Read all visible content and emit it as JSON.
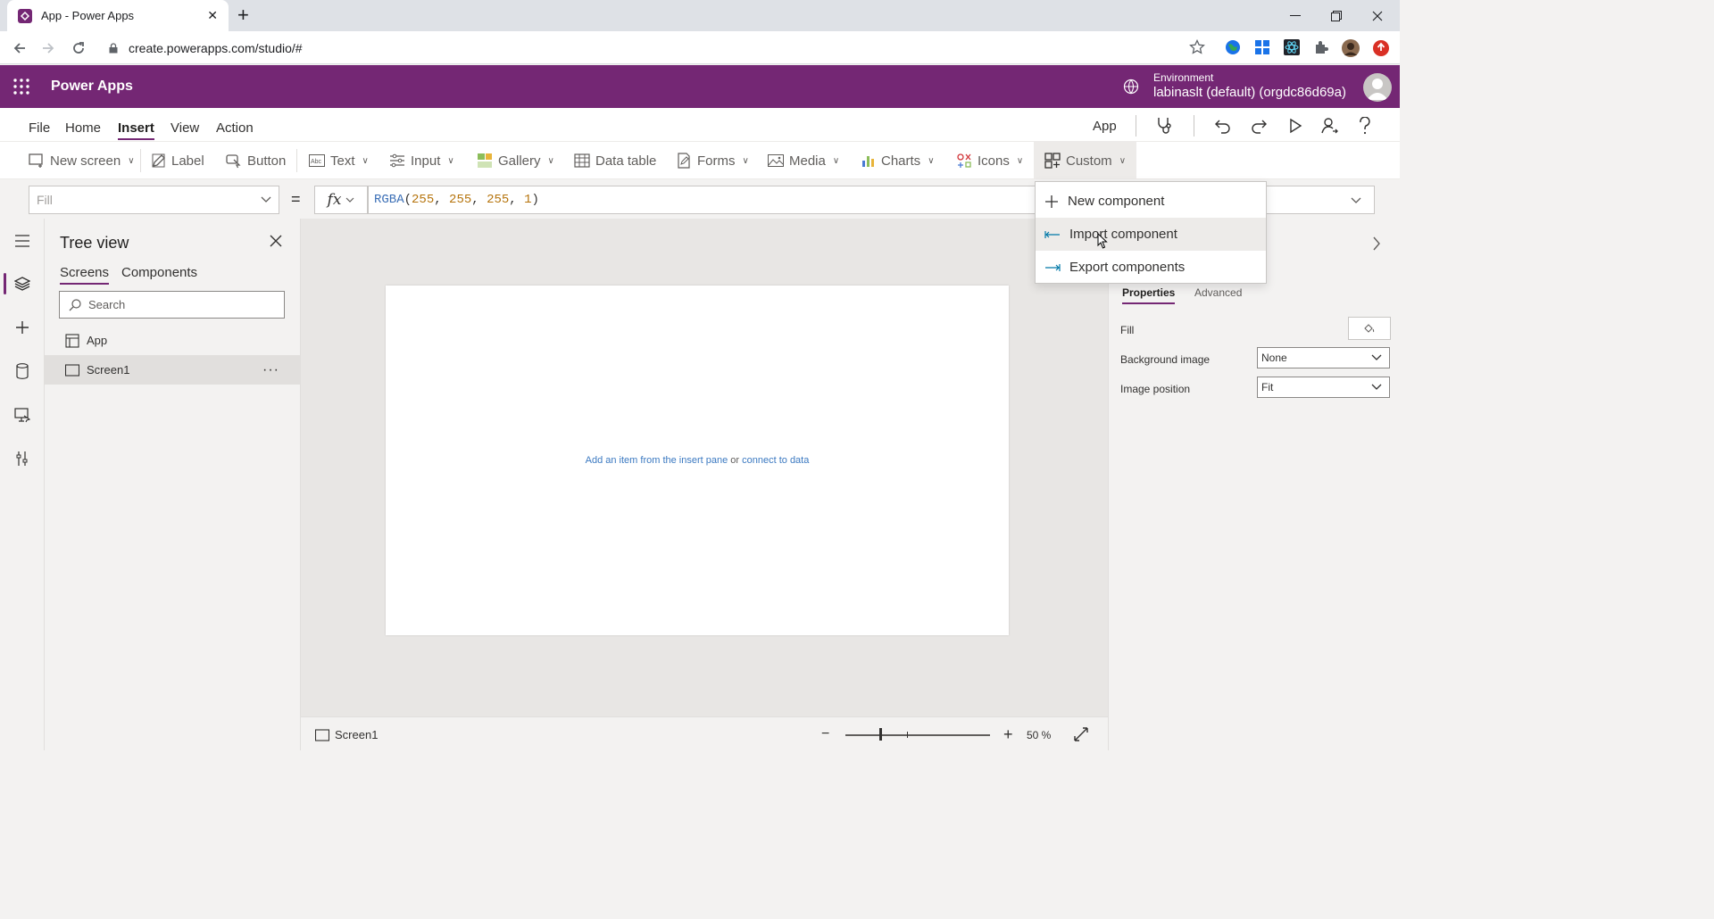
{
  "browser": {
    "tab_title": "App - Power Apps",
    "url": "create.powerapps.com/studio/#"
  },
  "header": {
    "app_name": "Power Apps",
    "environment_label": "Environment",
    "environment_value": "labinaslt (default) (orgdc86d69a)",
    "brand_color": "#742774"
  },
  "menu": {
    "tabs": [
      "File",
      "Home",
      "Insert",
      "View",
      "Action"
    ],
    "active_tab": "Insert",
    "app_label": "App"
  },
  "ribbon": {
    "new_screen": "New screen",
    "label": "Label",
    "button": "Button",
    "text": "Text",
    "input": "Input",
    "gallery": "Gallery",
    "data_table": "Data table",
    "forms": "Forms",
    "media": "Media",
    "charts": "Charts",
    "icons": "Icons",
    "custom": "Custom"
  },
  "formula": {
    "property": "Fill",
    "equals": "=",
    "fx": "fx",
    "fn": "RGBA",
    "open": "(",
    "a1": "255",
    "c1": ", ",
    "a2": "255",
    "c2": ", ",
    "a3": "255",
    "c3": ", ",
    "a4": "1",
    "close": ")"
  },
  "custom_menu": {
    "items": [
      "New component",
      "Import component",
      "Export components"
    ],
    "hovered": "Import component"
  },
  "tree": {
    "title": "Tree view",
    "tabs": [
      "Screens",
      "Components"
    ],
    "search_placeholder": "Search",
    "items": [
      "App",
      "Screen1"
    ],
    "more": "···"
  },
  "canvas": {
    "hint_link1": "Add an item from the insert pane",
    "hint_or": " or ",
    "hint_link2": "connect to data"
  },
  "status": {
    "screen_name": "Screen1",
    "zoom_minus": "−",
    "zoom_plus": "+",
    "zoom_value": "50 %"
  },
  "properties": {
    "tabs": [
      "Properties",
      "Advanced"
    ],
    "fill_label": "Fill",
    "bg_image_label": "Background image",
    "bg_image_value": "None",
    "image_pos_label": "Image position",
    "image_pos_value": "Fit"
  }
}
